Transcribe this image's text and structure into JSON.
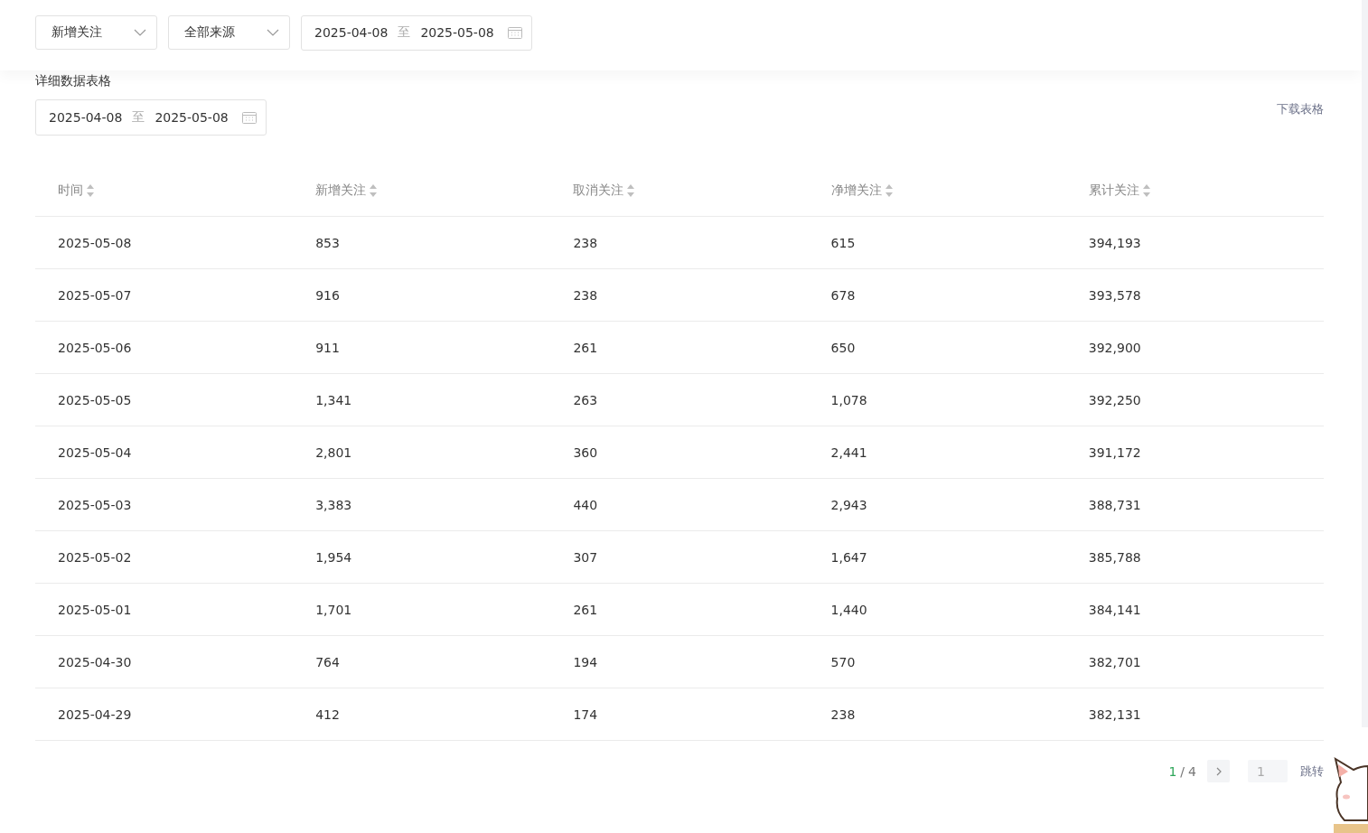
{
  "filters": {
    "metric": {
      "value": "新增关注"
    },
    "source": {
      "value": "全部来源"
    },
    "date_range": {
      "start": "2025-04-08",
      "separator": "至",
      "end": "2025-05-08"
    }
  },
  "section_title": "详细数据表格",
  "table_date_range": {
    "start": "2025-04-08",
    "separator": "至",
    "end": "2025-05-08"
  },
  "download_link": "下载表格",
  "table": {
    "columns": [
      "时间",
      "新增关注",
      "取消关注",
      "净增关注",
      "累计关注"
    ],
    "rows": [
      [
        "2025-05-08",
        "853",
        "238",
        "615",
        "394,193"
      ],
      [
        "2025-05-07",
        "916",
        "238",
        "678",
        "393,578"
      ],
      [
        "2025-05-06",
        "911",
        "261",
        "650",
        "392,900"
      ],
      [
        "2025-05-05",
        "1,341",
        "263",
        "1,078",
        "392,250"
      ],
      [
        "2025-05-04",
        "2,801",
        "360",
        "2,441",
        "391,172"
      ],
      [
        "2025-05-03",
        "3,383",
        "440",
        "2,943",
        "388,731"
      ],
      [
        "2025-05-02",
        "1,954",
        "307",
        "1,647",
        "385,788"
      ],
      [
        "2025-05-01",
        "1,701",
        "261",
        "1,440",
        "384,141"
      ],
      [
        "2025-04-30",
        "764",
        "194",
        "570",
        "382,701"
      ],
      [
        "2025-04-29",
        "412",
        "174",
        "238",
        "382,131"
      ]
    ]
  },
  "pagination": {
    "current": "1",
    "separator": "/",
    "total": "4",
    "page_input": "1",
    "jump": "跳转"
  }
}
